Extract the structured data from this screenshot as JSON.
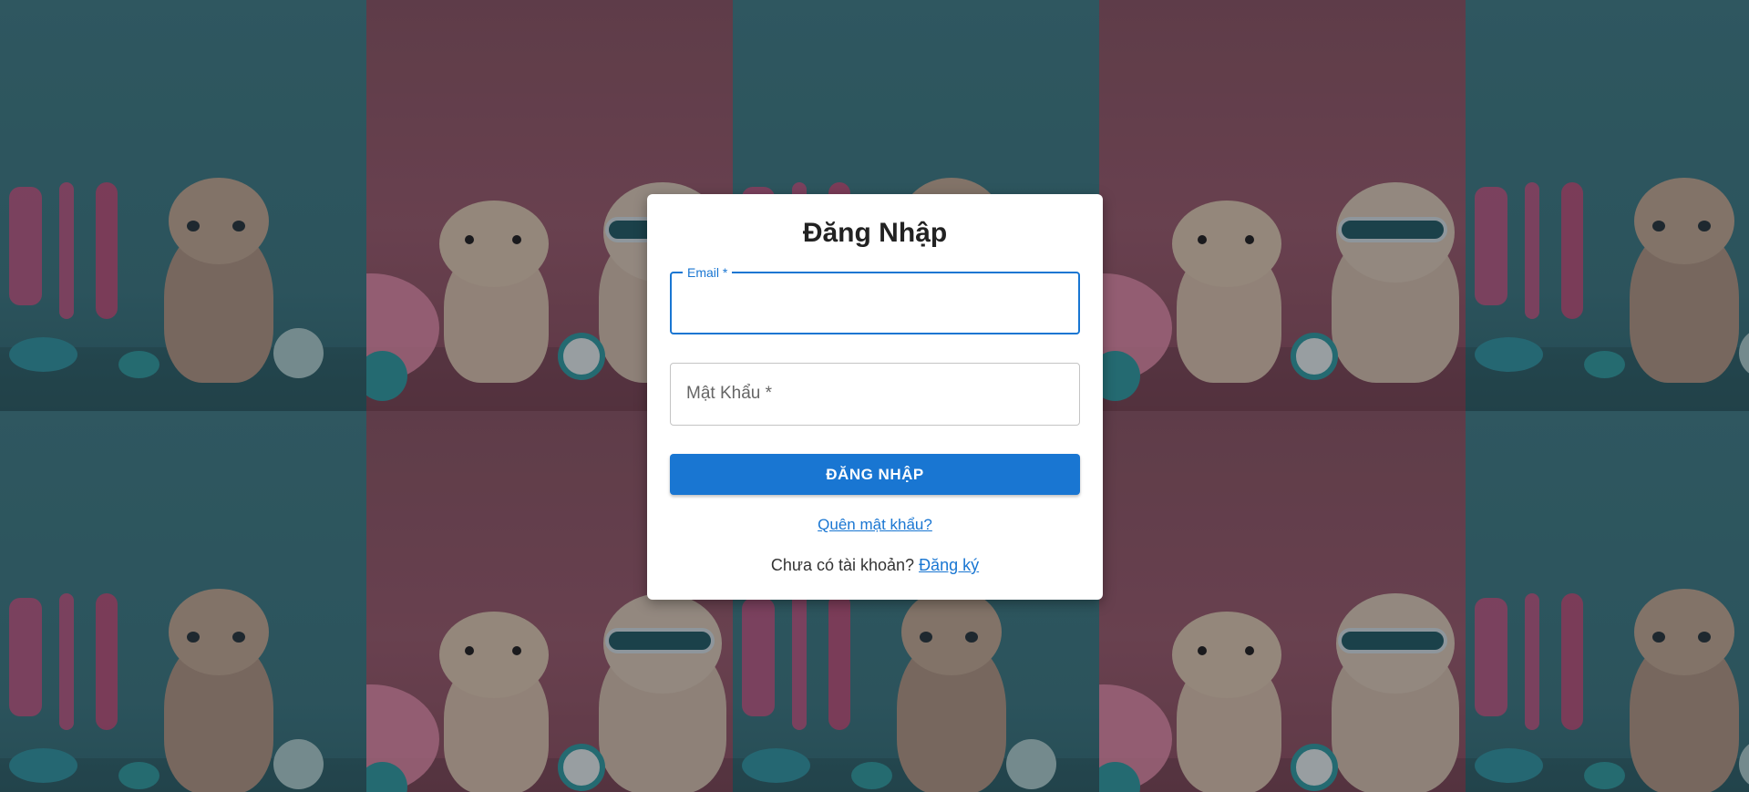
{
  "form": {
    "title": "Đăng Nhập",
    "email_label": "Email *",
    "email_value": "",
    "password_label": "Mật Khẩu *",
    "password_value": "",
    "submit_label": "ĐĂNG NHẬP",
    "forgot_label": "Quên mật khẩu?",
    "signup_prompt": "Chưa có tài khoản?",
    "signup_link": "Đăng ký"
  },
  "colors": {
    "primary": "#1976d2",
    "bg_teal": "#3f8089",
    "bg_pink": "#9c5c6e"
  }
}
